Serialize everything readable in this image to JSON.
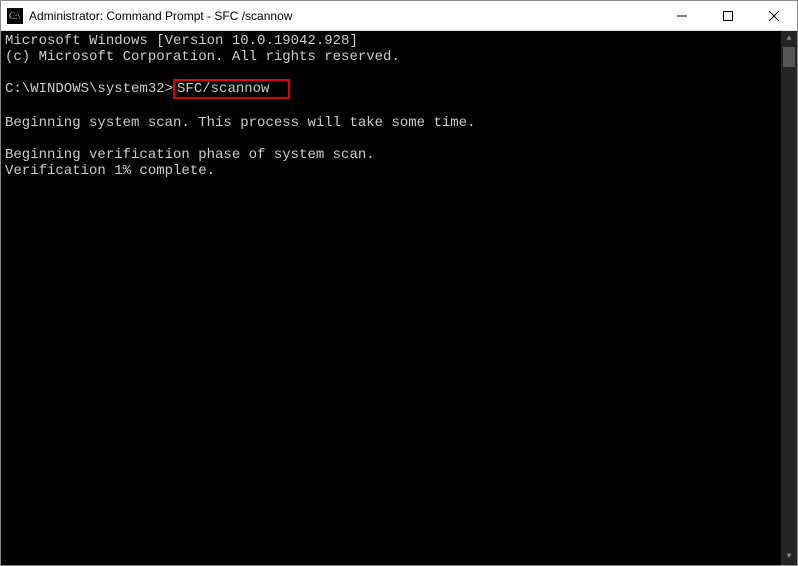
{
  "window": {
    "title": "Administrator: Command Prompt - SFC /scannow"
  },
  "terminal": {
    "line1": "Microsoft Windows [Version 10.0.19042.928]",
    "line2": "(c) Microsoft Corporation. All rights reserved.",
    "blank1": "",
    "prompt_path": "C:\\WINDOWS\\system32>",
    "command": "SFC/scannow",
    "blank2": "",
    "scan_start": "Beginning system scan.  This process will take some time.",
    "blank3": "",
    "verify_start": "Beginning verification phase of system scan.",
    "verify_progress": "Verification 1% complete."
  }
}
